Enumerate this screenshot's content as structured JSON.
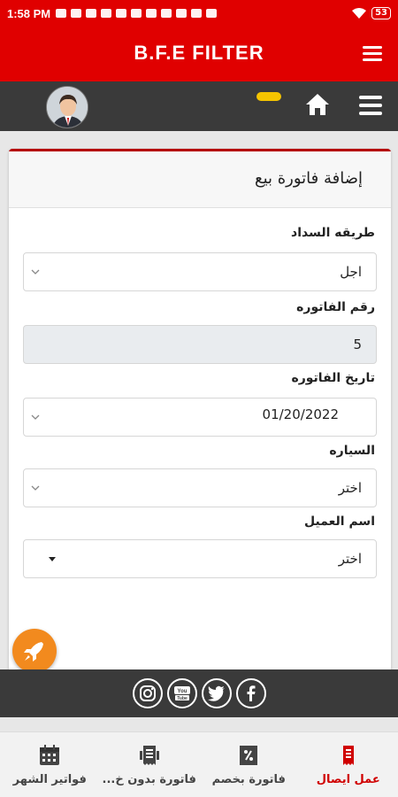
{
  "status_bar": {
    "time": "1:58 PM",
    "battery": "53"
  },
  "app_bar": {
    "title": "B.F.E  FILTER"
  },
  "card": {
    "title": "إضافة فاتورة بيع",
    "fields": [
      {
        "label": "طريقه السداد",
        "value": "اجل"
      },
      {
        "label": "رقم الفاتوره",
        "value": "5"
      },
      {
        "label": "تاريخ الفاتوره",
        "value": "01/20/2022"
      },
      {
        "label": "السياره",
        "value": "اختر"
      },
      {
        "label": "اسم العميل",
        "value": "اختر"
      }
    ]
  },
  "bottom_nav": {
    "tabs": [
      {
        "label": "فواتير الشهر",
        "icon": "calendar-icon"
      },
      {
        "label": "فاتورة بدون خ...",
        "icon": "invoice-icon"
      },
      {
        "label": "فاتورة بخصم",
        "icon": "discount-icon"
      },
      {
        "label": "عمل ايصال",
        "icon": "receipt-icon",
        "active": true
      }
    ]
  },
  "colors": {
    "primary": "#e00000",
    "dark": "#3a3a3a",
    "accent": "#f28a1e",
    "badge": "#f5c400"
  }
}
